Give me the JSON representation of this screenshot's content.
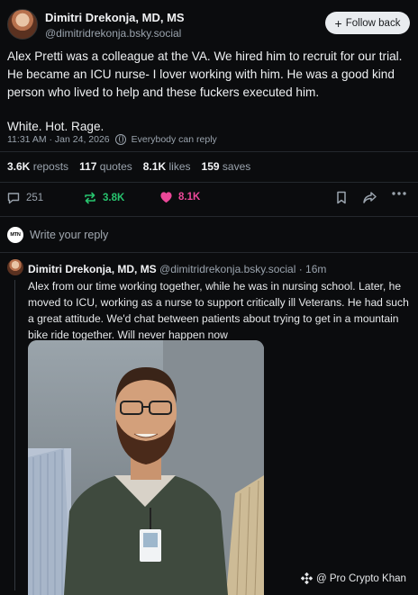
{
  "post": {
    "author": "Dimitri Drekonja, MD, MS",
    "handle": "@dimitridrekonja.bsky.social",
    "follow_label": "Follow back",
    "body_line1": "Alex Pretti was a colleague at the VA. We hired him to recruit for our trial. He became an ICU nurse- I lover working with him. He was a good kind person who lived to help and these fuckers executed him.",
    "body_line2": "White. Hot. Rage.",
    "timestamp": "11:31 AM · Jan 24, 2026",
    "visibility": "Everybody can reply"
  },
  "stats": {
    "reposts_count": "3.6K",
    "reposts_label": "reposts",
    "quotes_count": "117",
    "quotes_label": "quotes",
    "likes_count": "8.1K",
    "likes_label": "likes",
    "saves_count": "159",
    "saves_label": "saves"
  },
  "actions": {
    "reply_count": "251",
    "repost_count": "3.8K",
    "like_count": "8.1K",
    "colors": {
      "repost": "#27c46e",
      "like": "#ec4899",
      "muted": "#9aa3ad"
    }
  },
  "compose": {
    "avatar_text": "MTN",
    "placeholder": "Write your reply"
  },
  "reply": {
    "author": "Dimitri Drekonja, MD, MS",
    "handle": "@dimitridrekonja.bsky.social",
    "time": "· 16m",
    "body": "Alex from our time working together, while he was in nursing school. Later, he moved to ICU, working as a nurse to support critically ill Veterans. He had such a great attitude. We'd chat between patients about trying to get in a mountain bike ride together. Will never happen now"
  },
  "watermark": {
    "text": "@ Pro Crypto Khan",
    "icon": "binance-logo-icon"
  }
}
